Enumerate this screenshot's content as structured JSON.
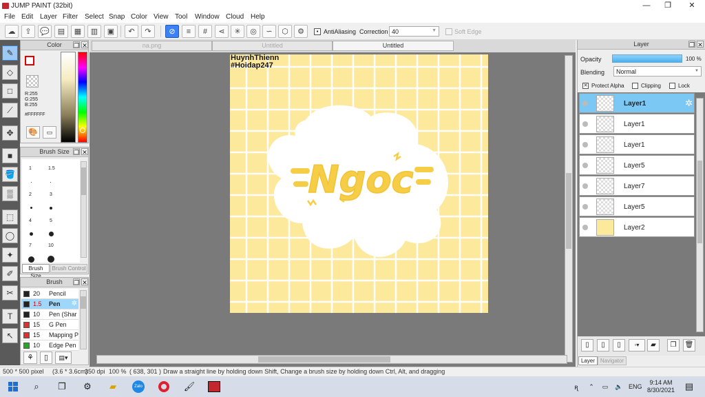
{
  "window": {
    "title": "JUMP PAINT (32bit)",
    "minimize": "—",
    "maximize": "❐",
    "close": "✕"
  },
  "menu": [
    "File",
    "Edit",
    "Layer",
    "Filter",
    "Select",
    "Snap",
    "Color",
    "View",
    "Tool",
    "Window",
    "Cloud",
    "Help"
  ],
  "toolbar": {
    "antialiasing_label": "AntiAliasing",
    "correction_label": "Correction",
    "correction_value": "40",
    "softedge_label": "Soft Edge"
  },
  "color_panel": {
    "title": "Color",
    "r": "R:255",
    "g": "G:255",
    "b": "B:255",
    "hex": "#FFFFFF"
  },
  "brush_size_panel": {
    "title": "Brush Size",
    "sizes": [
      "1",
      "1.5",
      "2",
      "3",
      "4",
      "5",
      "7",
      "10"
    ],
    "tab1": "Brush Size",
    "tab2": "Brush Control"
  },
  "brush_panel": {
    "title": "Brush",
    "items": [
      {
        "size": "20",
        "name": "Pencil",
        "color": "#222222"
      },
      {
        "size": "1.5",
        "name": "Pen",
        "color": "#222222",
        "selected": true
      },
      {
        "size": "10",
        "name": "Pen (Shar",
        "color": "#222222"
      },
      {
        "size": "15",
        "name": "G Pen",
        "color": "#e03030"
      },
      {
        "size": "15",
        "name": "Mapping P",
        "color": "#e03030"
      },
      {
        "size": "10",
        "name": "Edge Pen",
        "color": "#22aa22"
      }
    ]
  },
  "canvas_tabs": [
    "na.png",
    "Untitled",
    "Untitled"
  ],
  "canvas": {
    "watermark_line1": "HuynhThienn",
    "watermark_line2": "#Hoidap247",
    "art_text": "Ngoc",
    "background": "#fde99c",
    "grid_color": "#ffffff",
    "lettering_color": "#f7cf48"
  },
  "layer_panel": {
    "title": "Layer",
    "opacity_label": "Opacity",
    "opacity_value": "100 %",
    "blending_label": "Blending",
    "blending_value": "Normal",
    "protect_alpha": "Protect Alpha",
    "clipping": "Clipping",
    "lock": "Lock",
    "layers": [
      "Layer1",
      "Layer1",
      "Layer1",
      "Layer5",
      "Layer7",
      "Layer5",
      "Layer2"
    ],
    "tab_layer": "Layer",
    "tab_navigator": "Navigator"
  },
  "status": {
    "size": "500 * 500 pixel",
    "cm": "(3.6 * 3.6cm)",
    "dpi": "350 dpi",
    "zoom": "100 %",
    "coords": "( 638, 301 )",
    "hint": "Draw a straight line by holding down Shift, Change a brush size by holding down Ctrl, Alt, and dragging"
  },
  "taskbar": {
    "lang": "ENG",
    "time": "9:14 AM",
    "date": "8/30/2021"
  }
}
